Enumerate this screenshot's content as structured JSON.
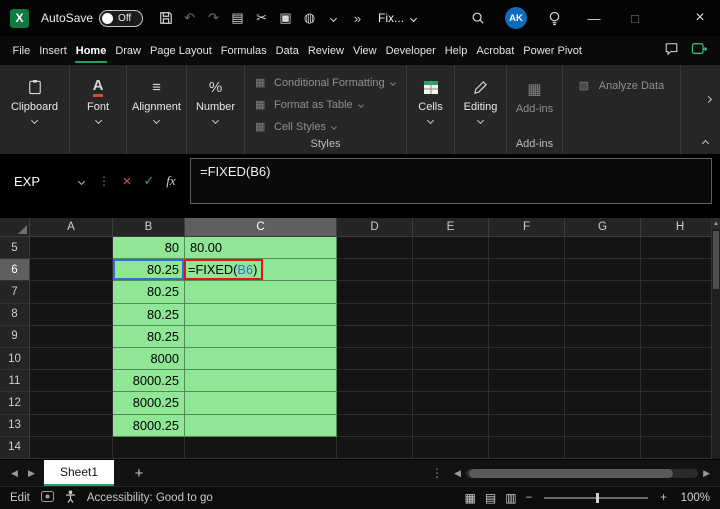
{
  "colors": {
    "green_fill": "#8fe796",
    "reference_blue": "#2f6fd6",
    "annotation_red": "#e01515",
    "accent_green": "#27a163",
    "cancel_red": "#e05252",
    "enter_green": "#3fa45f",
    "avatar_blue": "#0f6cbd"
  },
  "icons": {
    "undo": "↶",
    "redo": "↷",
    "copy": "▤",
    "cut": "✂",
    "paste": "▣",
    "globe": "◍",
    "more_commands": "»",
    "font": "A",
    "alignment": "≡",
    "number": "%",
    "style_grid": "▦",
    "addins_grid": "▦",
    "analyze_grid": "▧",
    "cancel": "×",
    "enter": "✓",
    "minimize": "—",
    "maximize": "□",
    "close": "×",
    "tab_prev": "◀",
    "tab_next": "▶",
    "scroll_left": "◀",
    "scroll_right": "▶",
    "scroll_up": "▲",
    "dots_vertical": "⋮",
    "add_sheet": "+",
    "view_normal": "▦",
    "view_layout": "▤",
    "view_break": "▥",
    "zoom_out": "−",
    "zoom_in": "+"
  },
  "titlebar": {
    "autosave_label": "AutoSave",
    "autosave_state": "Off",
    "file_name": "Fix...",
    "avatar_initials": "AK"
  },
  "menubar": {
    "items": [
      "File",
      "Insert",
      "Home",
      "Draw",
      "Page Layout",
      "Formulas",
      "Data",
      "Review",
      "View",
      "Developer",
      "Help",
      "Acrobat",
      "Power Pivot"
    ],
    "active_item": "Home"
  },
  "ribbon": {
    "big_buttons": [
      "Clipboard",
      "Font",
      "Alignment",
      "Number"
    ],
    "styles_items": [
      "Conditional Formatting",
      "Format as Table",
      "Cell Styles"
    ],
    "styles_group_label": "Styles",
    "cells_label": "Cells",
    "editing_label": "Editing",
    "addins_label": "Add-ins",
    "addins_group_label": "Add-ins",
    "analyze_data_label": "Analyze Data"
  },
  "formula_bar": {
    "name_box": "EXP",
    "fx_label": "fx",
    "formula": "=FIXED(B6)"
  },
  "grid": {
    "column_headers": [
      "A",
      "B",
      "C",
      "D",
      "E",
      "F",
      "G",
      "H"
    ],
    "selected_column": "C",
    "selected_row": "6",
    "rows": [
      {
        "n": "5",
        "b": "80",
        "c": "80.00"
      },
      {
        "n": "6",
        "b": "80.25"
      },
      {
        "n": "7",
        "b": "80.25"
      },
      {
        "n": "8",
        "b": "80.25"
      },
      {
        "n": "9",
        "b": "80.25"
      },
      {
        "n": "10",
        "b": "8000"
      },
      {
        "n": "11",
        "b": "8000.25"
      },
      {
        "n": "12",
        "b": "8000.25"
      },
      {
        "n": "13",
        "b": "8000.25"
      },
      {
        "n": "14"
      }
    ],
    "editing_cell": {
      "prefix": "=FIXED(",
      "reference": "B6",
      "suffix": ")"
    }
  },
  "sheet_bar": {
    "tab_label": "Sheet1"
  },
  "status_bar": {
    "mode": "Edit",
    "accessibility_text": "Accessibility: Good to go",
    "zoom_level": "100%"
  }
}
